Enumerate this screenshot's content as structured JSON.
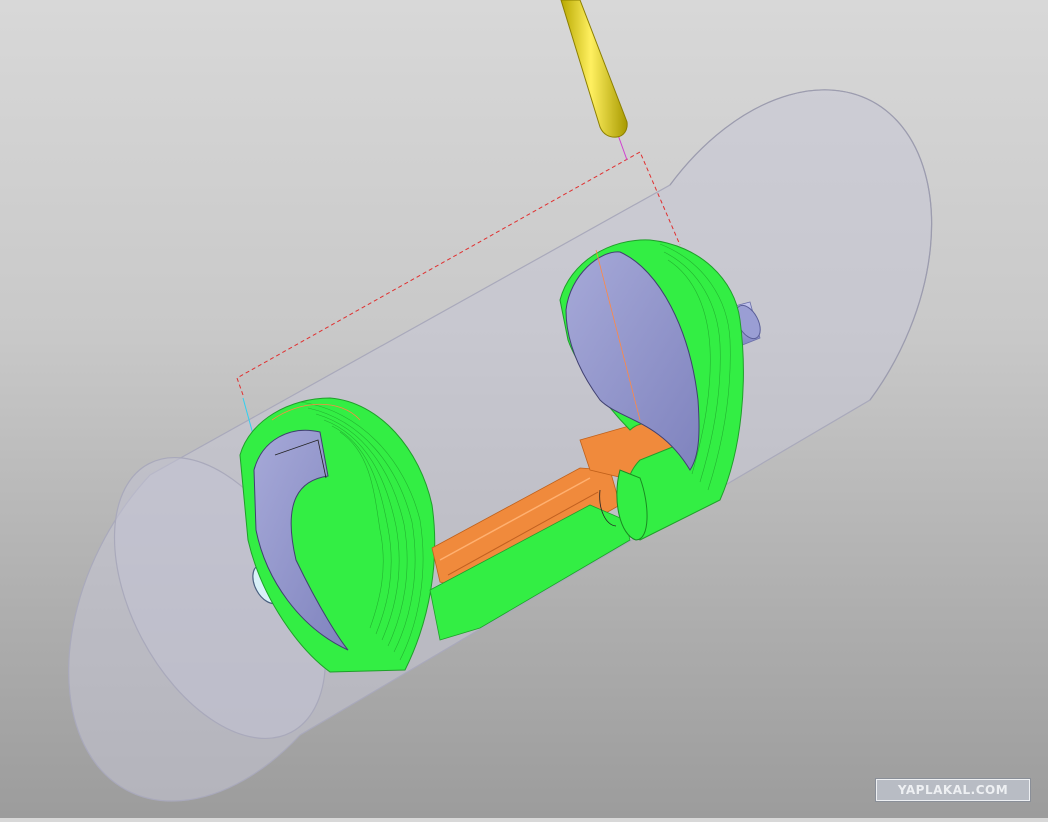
{
  "scene": {
    "background_colors": [
      "#d8d8d8",
      "#9c9c9c"
    ],
    "stock_color": "#c6c6d6",
    "toolpath_color": "#33ee44",
    "part_color": "#f08a3c",
    "tool_color": "#e0d020",
    "end_face_color": "#8f93c8",
    "link_move_color": "#e03030"
  },
  "watermark": {
    "text": "YAPLAKAL.COM"
  }
}
